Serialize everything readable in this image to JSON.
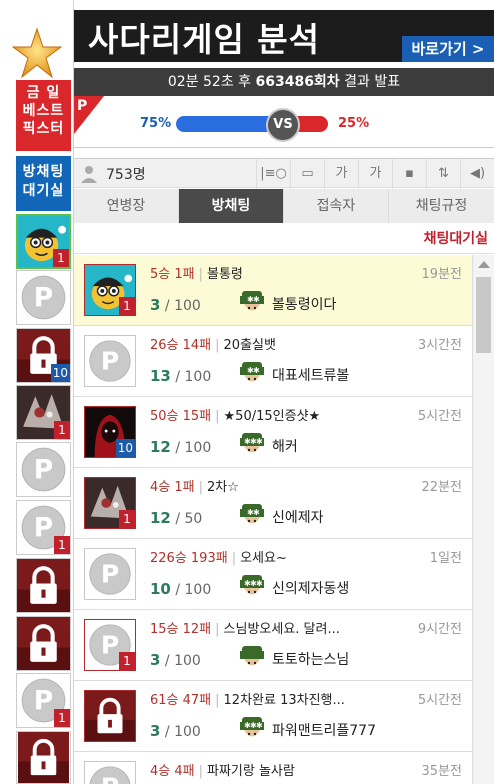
{
  "left": {
    "best_label": "금 일\n베스트\n픽스터",
    "best_lines": [
      "금 일",
      "베스트",
      "픽스터"
    ],
    "waitroom_lines": [
      "방채팅",
      "대기실"
    ],
    "thumbs": [
      {
        "icon": "cartoon-avatar-icon",
        "badge": "1",
        "badge_color": "red"
      },
      {
        "icon": "default-p-avatar-icon",
        "badge": ""
      },
      {
        "icon": "lock-icon",
        "badge": "10",
        "badge_color": "blue"
      },
      {
        "icon": "creature-avatar-icon",
        "badge": "1",
        "badge_color": "red"
      },
      {
        "icon": "default-p-avatar-icon",
        "badge": ""
      },
      {
        "icon": "default-p-avatar-icon",
        "badge": "1",
        "badge_color": "red"
      },
      {
        "icon": "lock-icon",
        "badge": ""
      },
      {
        "icon": "lock-icon",
        "badge": ""
      },
      {
        "icon": "default-p-avatar-icon",
        "badge": "1",
        "badge_color": "red"
      },
      {
        "icon": "lock-icon",
        "badge": ""
      }
    ]
  },
  "banner": {
    "title": "사다리게임 분석",
    "button": "바로가기 >"
  },
  "announce": {
    "time": "02분 52초 후",
    "round": "663486회차",
    "suffix": "결과 발표"
  },
  "vs": {
    "flag": "P",
    "left_pct": "75%",
    "right_pct": "25%",
    "center": "VS",
    "left_fraction": 0.75
  },
  "toolbar": {
    "user_count": "753명",
    "buttons": [
      "layout-icon",
      "window-icon",
      "font-large-icon",
      "font-small-icon",
      "save-icon",
      "sort-icon",
      "speaker-icon"
    ],
    "btn_labels": [
      "|≡○",
      "▭",
      "가",
      "가",
      "▪",
      "⇅",
      "◀)"
    ]
  },
  "tabs": [
    "연병장",
    "방채팅",
    "접속자",
    "채팅규정"
  ],
  "active_tab": "방채팅",
  "room_header": "채팅대기실",
  "rooms": [
    {
      "record": "5승 1패",
      "title": "볼통령",
      "time": "19분전",
      "current": "3",
      "max": "100",
      "host": "볼통령이다",
      "avatar": "cartoon-avatar-icon",
      "badge": "1",
      "badge_color": "red",
      "host_stars": 2
    },
    {
      "record": "26승 14패",
      "title": "20출실뱃",
      "time": "3시간전",
      "current": "13",
      "max": "100",
      "host": "대표세트류볼",
      "avatar": "default-p-avatar-icon",
      "badge": "",
      "host_stars": 2
    },
    {
      "record": "50승 15패",
      "title": "★50/15인증샷★",
      "time": "5시간전",
      "current": "12",
      "max": "100",
      "host": "해커",
      "avatar": "hooded-avatar-icon",
      "badge": "10",
      "badge_color": "blue",
      "host_stars": 3
    },
    {
      "record": "4승 1패",
      "title": "2차☆",
      "time": "22분전",
      "current": "12",
      "max": "50",
      "host": "신에제자",
      "avatar": "creature-avatar-icon",
      "badge": "1",
      "badge_color": "red",
      "host_stars": 2
    },
    {
      "record": "226승 193패",
      "title": "오세요~",
      "time": "1일전",
      "current": "10",
      "max": "100",
      "host": "신의제자동생",
      "avatar": "default-p-avatar-icon",
      "badge": "",
      "host_stars": 3
    },
    {
      "record": "15승 12패",
      "title": "스님방오세요. 달려...",
      "time": "9시간전",
      "current": "3",
      "max": "100",
      "host": "토토하는스님",
      "avatar": "default-p-avatar-icon",
      "badge": "1",
      "badge_color": "red",
      "host_stars": 0
    },
    {
      "record": "61승 47패",
      "title": "12차완료 13차진행...",
      "time": "5시간전",
      "current": "3",
      "max": "100",
      "host": "파워맨트리플777",
      "avatar": "lock-icon",
      "badge": "",
      "host_stars": 3
    },
    {
      "record": "4승 4패",
      "title": "파짜기랑 놀사람",
      "time": "35분전",
      "current": "",
      "max": "",
      "host": "",
      "avatar": "default-p-avatar-icon",
      "badge": "",
      "host_stars": 0
    }
  ],
  "colors": {
    "accent_blue": "#1a5fb4",
    "accent_red": "#d9272c",
    "highlight": "#fdfad6"
  }
}
